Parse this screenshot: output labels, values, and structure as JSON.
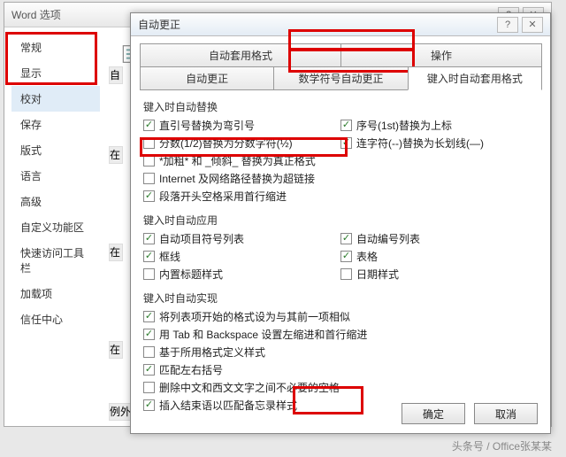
{
  "parent": {
    "title": "Word 选项",
    "sidebar": [
      "常规",
      "显示",
      "校对",
      "保存",
      "版式",
      "语言",
      "高级",
      "自定义功能区",
      "快速访问工具栏",
      "加载项",
      "信任中心"
    ],
    "selected_index": 2,
    "section_labels": [
      "自",
      "在",
      "在",
      "在",
      "例外"
    ]
  },
  "child": {
    "title": "自动更正",
    "tabs_row1": [
      "自动套用格式",
      "操作"
    ],
    "tabs_row2": [
      "自动更正",
      "数学符号自动更正",
      "键入时自动套用格式"
    ],
    "sections": {
      "s1": {
        "title": "键入时自动替换",
        "items": [
          {
            "label": "直引号替换为弯引号",
            "checked": true,
            "pair": {
              "label": "序号(1st)替换为上标",
              "checked": true
            }
          },
          {
            "label": "分数(1/2)替换为分数字符(½)",
            "checked": false,
            "pair": {
              "label": "连字符(--)替换为长划线(—)",
              "checked": true
            }
          },
          {
            "label": "*加粗* 和 _倾斜_ 替换为真正格式",
            "checked": false
          },
          {
            "label": "Internet 及网络路径替换为超链接",
            "checked": false
          },
          {
            "label": "段落开头空格采用首行缩进",
            "checked": true
          }
        ]
      },
      "s2": {
        "title": "键入时自动应用",
        "items": [
          {
            "label": "自动项目符号列表",
            "checked": true,
            "pair": {
              "label": "自动编号列表",
              "checked": true
            }
          },
          {
            "label": "框线",
            "checked": true,
            "pair": {
              "label": "表格",
              "checked": true
            }
          },
          {
            "label": "内置标题样式",
            "checked": false,
            "pair": {
              "label": "日期样式",
              "checked": false
            }
          }
        ]
      },
      "s3": {
        "title": "键入时自动实现",
        "items": [
          {
            "label": "将列表项开始的格式设为与其前一项相似",
            "checked": true
          },
          {
            "label": "用 Tab 和 Backspace 设置左缩进和首行缩进",
            "checked": true
          },
          {
            "label": "基于所用格式定义样式",
            "checked": false
          },
          {
            "label": "匹配左右括号",
            "checked": true
          },
          {
            "label": "删除中文和西文文字之间不必要的空格",
            "checked": false
          },
          {
            "label": "插入结束语以匹配备忘录样式",
            "checked": true
          }
        ]
      }
    },
    "buttons": {
      "ok": "确定",
      "cancel": "取消"
    }
  },
  "watermark": "头条号 / Office张某某"
}
